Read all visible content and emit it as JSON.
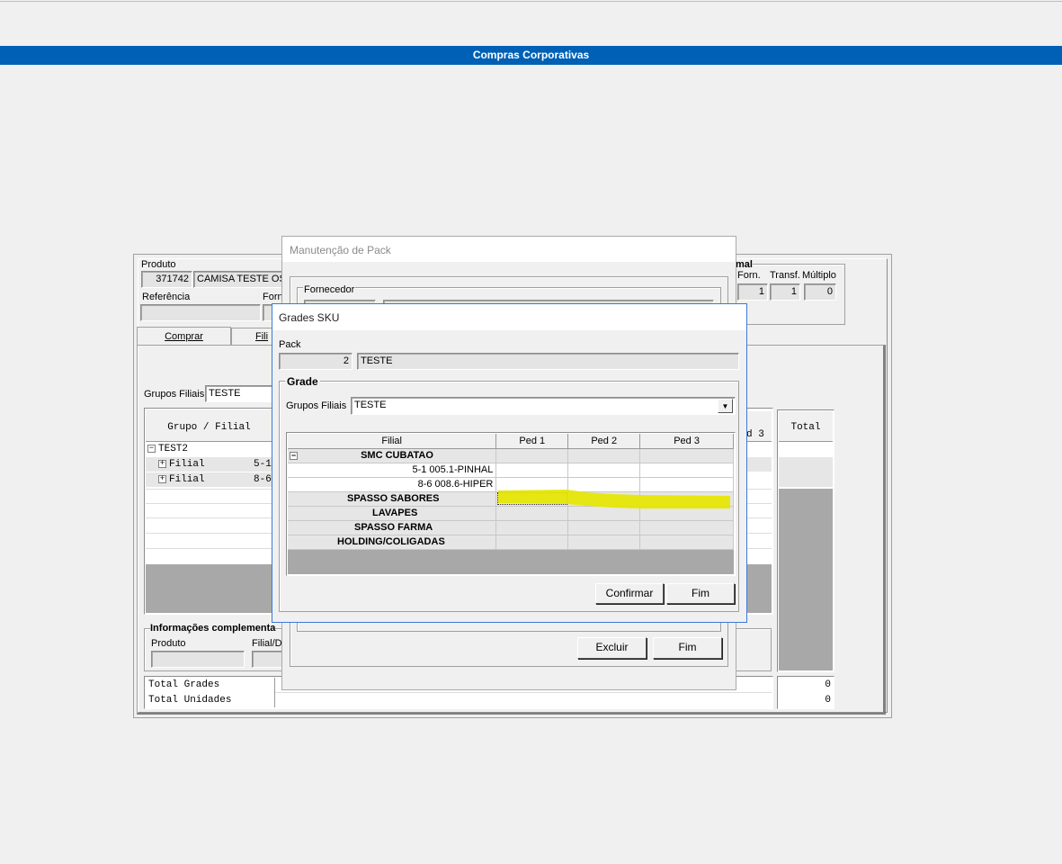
{
  "app": {
    "title": "Compras Corporativas"
  },
  "background_form": {
    "produto_label": "Produto",
    "produto_code": "371742",
    "produto_name": "CAMISA TESTE OS",
    "referencia_label": "Referência",
    "forn_label_partial": "Forn",
    "right_header_partial": "mal",
    "forn_label": "Forn.",
    "transf_label": "Transf.",
    "multiplo_label": "Múltiplo",
    "forn_value": "1",
    "transf_value": "1",
    "multiplo_value": "0",
    "tabs": [
      {
        "label": "Comprar"
      },
      {
        "label": "Fili"
      }
    ],
    "grupos_filiais_label": "Grupos Filiais",
    "grupos_filiais_value": "TESTE",
    "tree_header": "Grupo / Filial",
    "tree": [
      {
        "label": "TEST2",
        "code": ""
      },
      {
        "label": "Filial",
        "code": "5-1"
      },
      {
        "label": "Filial",
        "code": "8-6"
      }
    ],
    "ped3_header_partial": "d 3",
    "total_header": "Total",
    "info_group_label": "Informações complementa",
    "info_produto_label": "Produto",
    "info_filial_label": "Filial/De",
    "total_grades_label": "Total Grades",
    "total_unidades_label": "Total Unidades",
    "total_grades_value": "0",
    "total_unidades_value": "0"
  },
  "pack_dialog": {
    "title": "Manutenção de Pack",
    "fornecedor_label": "Fornecedor",
    "excluir_label": "Excluir",
    "fim_label": "Fim"
  },
  "sku_dialog": {
    "title": "Grades SKU",
    "pack_label": "Pack",
    "pack_code": "2",
    "pack_name": "TESTE",
    "grade_group_label": "Grade",
    "grupos_filiais_label": "Grupos Filiais",
    "grupos_filiais_value": "TESTE",
    "columns": [
      "Filial",
      "Ped 1",
      "Ped 2",
      "Ped 3"
    ],
    "rows": [
      {
        "label": "SMC CUBATAO",
        "kind": "group"
      },
      {
        "label": "5-1  005.1-PINHAL",
        "kind": "item"
      },
      {
        "label": "8-6  008.6-HIPER",
        "kind": "item"
      },
      {
        "label": "SPASSO SABORES",
        "kind": "group"
      },
      {
        "label": "LAVAPES",
        "kind": "group"
      },
      {
        "label": "SPASSO FARMA",
        "kind": "group"
      },
      {
        "label": "HOLDING/COLIGADAS",
        "kind": "group"
      }
    ],
    "confirmar_label": "Confirmar",
    "fim_label": "Fim",
    "highlight_color": "#e6e600"
  }
}
